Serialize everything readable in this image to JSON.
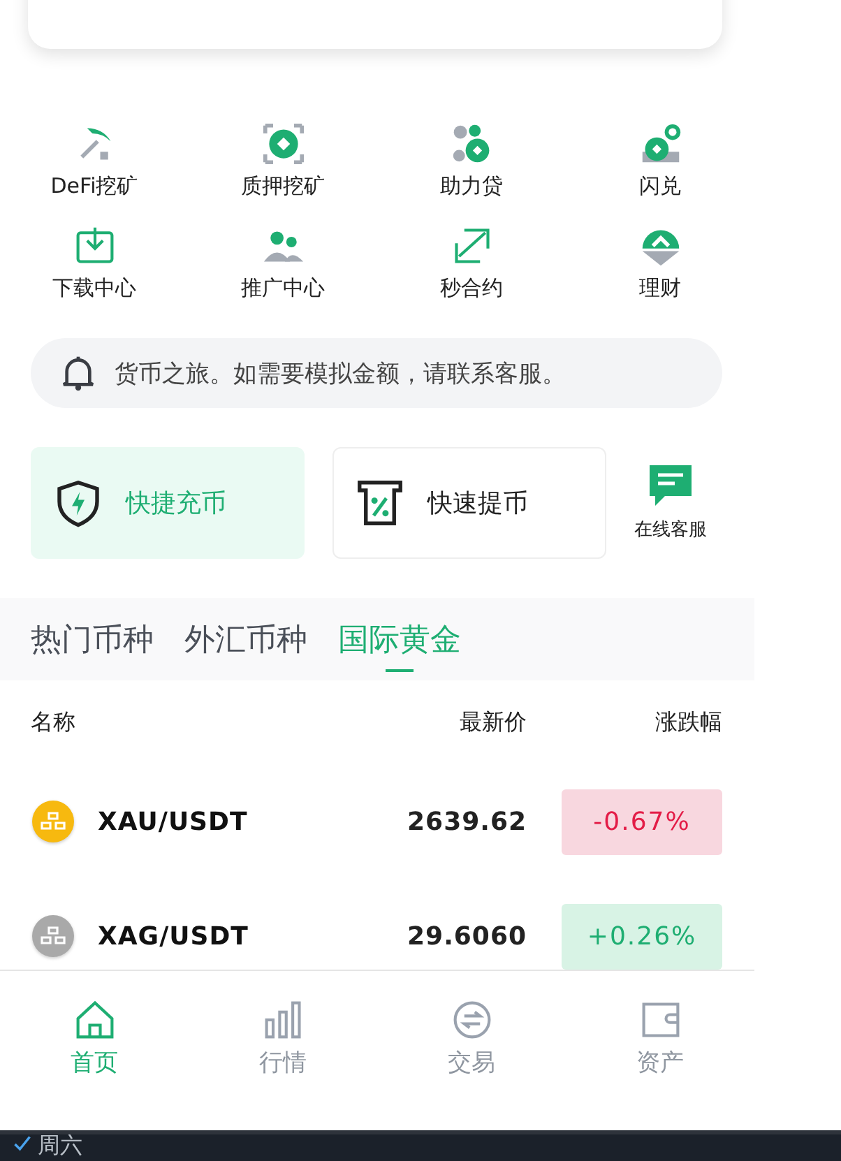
{
  "quick_menu": [
    {
      "label": "DeFi挖矿",
      "kind": "pickaxe"
    },
    {
      "label": "质押挖矿",
      "kind": "coin-frame"
    },
    {
      "label": "助力贷",
      "kind": "bubbles"
    },
    {
      "label": "闪兑",
      "kind": "coins-stack"
    },
    {
      "label": "下载中心",
      "kind": "download"
    },
    {
      "label": "推广中心",
      "kind": "people"
    },
    {
      "label": "秒合约",
      "kind": "chart"
    },
    {
      "label": "理财",
      "kind": "bowl"
    }
  ],
  "notice": {
    "text": "货币之旅。如需要模拟金额，请联系客服。"
  },
  "actions": [
    {
      "label": "快捷充币",
      "kind": "shield",
      "selected": true
    },
    {
      "label": "快速提币",
      "kind": "atm",
      "selected": false
    }
  ],
  "support": {
    "label": "在线客服"
  },
  "tabs": [
    {
      "label": "热门币种",
      "selected": false
    },
    {
      "label": "外汇币种",
      "selected": false
    },
    {
      "label": "国际黄金",
      "selected": true
    }
  ],
  "table": {
    "columns": [
      "名称",
      "最新价",
      "涨跌幅"
    ],
    "rows": [
      {
        "symbol": "XAU/USDT",
        "price": "2639.62",
        "change": "-0.67%",
        "rising": false,
        "color": "#f7b90f"
      },
      {
        "symbol": "XAG/USDT",
        "price": "29.6060",
        "change": "+0.26%",
        "rising": true,
        "color": "#a9a9a9"
      }
    ]
  },
  "nav": [
    {
      "label": "首页",
      "kind": "home",
      "selected": true
    },
    {
      "label": "行情",
      "kind": "bars",
      "selected": false
    },
    {
      "label": "交易",
      "kind": "exchange",
      "selected": false
    },
    {
      "label": "资产",
      "kind": "wallet",
      "selected": false
    }
  ],
  "taskbar": {
    "day": "周六"
  }
}
